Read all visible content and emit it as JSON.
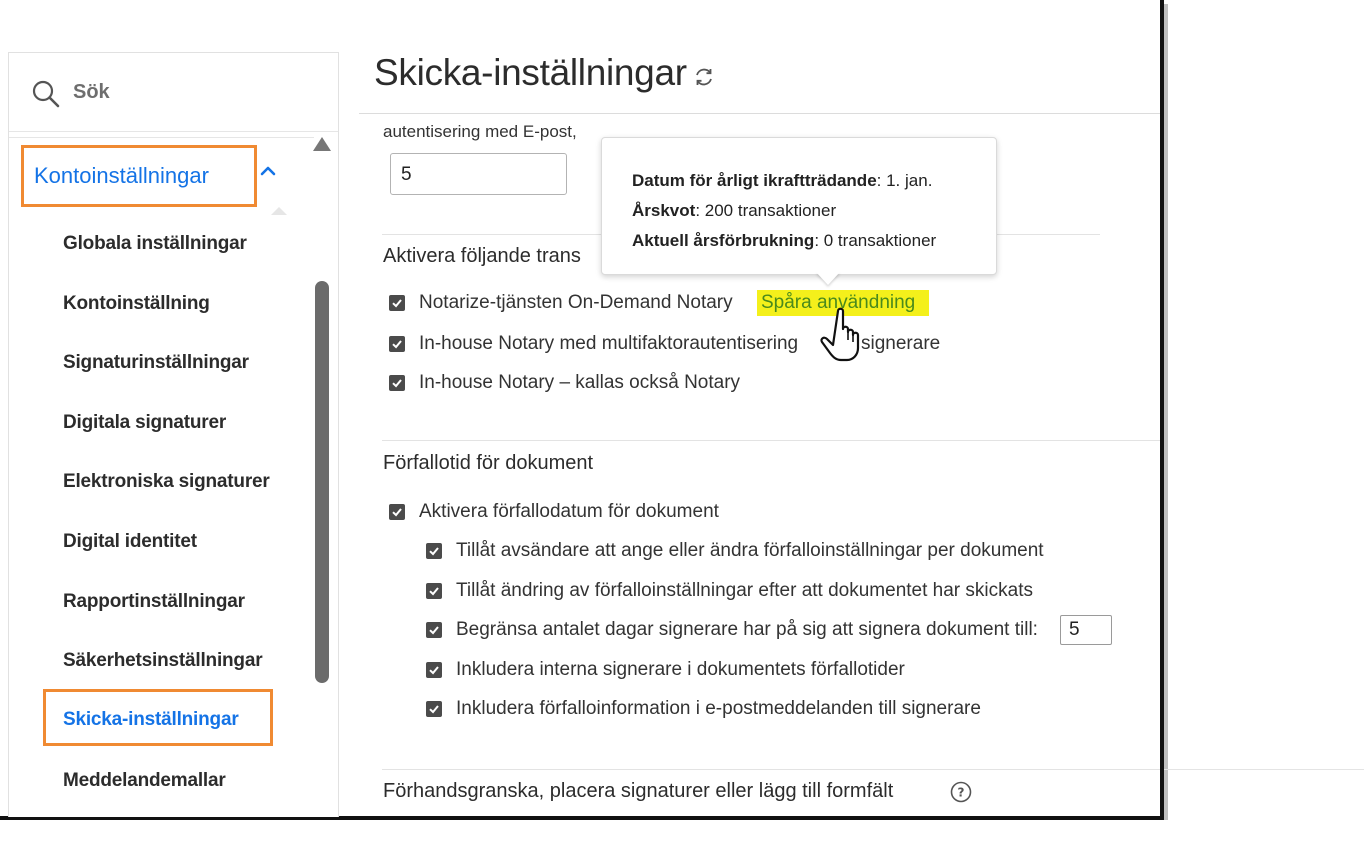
{
  "sidebar": {
    "search_label": "Sök",
    "section_label": "Kontoinställningar",
    "items": [
      {
        "label": "Globala inställningar"
      },
      {
        "label": "Kontoinställning"
      },
      {
        "label": "Signaturinställningar"
      },
      {
        "label": "Digitala signaturer"
      },
      {
        "label": "Elektroniska signaturer"
      },
      {
        "label": "Digital identitet"
      },
      {
        "label": "Rapportinställningar"
      },
      {
        "label": "Säkerhetsinställningar"
      },
      {
        "label": "Skicka-inställningar"
      },
      {
        "label": "Meddelandemallar"
      }
    ],
    "active_item": "Skicka-inställningar"
  },
  "main": {
    "title": "Skicka-inställningar",
    "auth_label": "autentisering med E-post,",
    "auth_value": "5",
    "transaction_heading": "Aktivera följande trans",
    "transactions": [
      {
        "label": "Notarize-tjänsten On-Demand Notary",
        "link": "Spåra användning"
      },
      {
        "label": "In-house Notary med multifaktorautentisering",
        "suffix": "signerare"
      },
      {
        "label": "In-house Notary – kallas också Notary"
      }
    ],
    "expiry_heading": "Förfallotid för dokument",
    "expiry_enable": "Aktivera förfallodatum för dokument",
    "expiry_options": [
      {
        "label": "Tillåt avsändare att ange eller ändra förfalloinställningar per dokument"
      },
      {
        "label": "Tillåt ändring av förfalloinställningar efter att dokumentet har skickats"
      },
      {
        "label": "Begränsa antalet dagar signerare har på sig att signera dokument till:",
        "value": "5"
      },
      {
        "label": "Inkludera interna signerare i dokumentets förfallotider"
      },
      {
        "label": "Inkludera förfalloinformation i e-postmeddelanden till signerare"
      }
    ],
    "preview_heading": "Förhandsgranska, placera signaturer eller lägg till formfält"
  },
  "tooltip": {
    "line1_label": "Datum för årligt ikraftträdande",
    "line1_value": ": 1. jan.",
    "line2_label": "Årskvot",
    "line2_value": ": 200 transaktioner",
    "line3_label": "Aktuell årsförbrukning",
    "line3_value": ": 0 transaktioner"
  },
  "colors": {
    "accent": "#1473e6",
    "highlight_box": "#f08a32",
    "link_highlight": "#f4f01b",
    "link_text": "#4a8a1c"
  },
  "icons": [
    "search-icon",
    "chevron-up-icon",
    "scroll-up-arrow-icon",
    "refresh-icon",
    "checkbox-checked-icon",
    "help-icon",
    "hand-cursor-icon"
  ]
}
